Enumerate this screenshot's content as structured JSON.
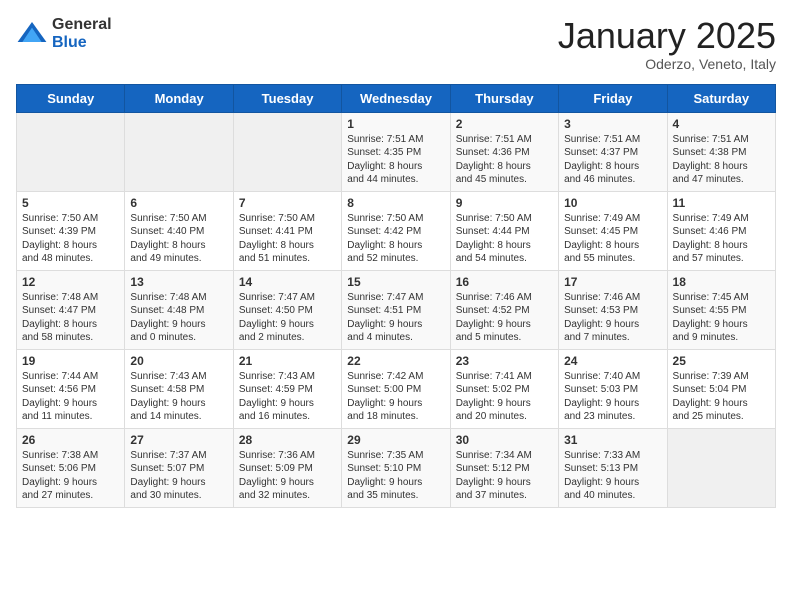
{
  "logo": {
    "general": "General",
    "blue": "Blue"
  },
  "header": {
    "month": "January 2025",
    "location": "Oderzo, Veneto, Italy"
  },
  "weekdays": [
    "Sunday",
    "Monday",
    "Tuesday",
    "Wednesday",
    "Thursday",
    "Friday",
    "Saturday"
  ],
  "weeks": [
    [
      {
        "day": "",
        "info": ""
      },
      {
        "day": "",
        "info": ""
      },
      {
        "day": "",
        "info": ""
      },
      {
        "day": "1",
        "info": "Sunrise: 7:51 AM\nSunset: 4:35 PM\nDaylight: 8 hours\nand 44 minutes."
      },
      {
        "day": "2",
        "info": "Sunrise: 7:51 AM\nSunset: 4:36 PM\nDaylight: 8 hours\nand 45 minutes."
      },
      {
        "day": "3",
        "info": "Sunrise: 7:51 AM\nSunset: 4:37 PM\nDaylight: 8 hours\nand 46 minutes."
      },
      {
        "day": "4",
        "info": "Sunrise: 7:51 AM\nSunset: 4:38 PM\nDaylight: 8 hours\nand 47 minutes."
      }
    ],
    [
      {
        "day": "5",
        "info": "Sunrise: 7:50 AM\nSunset: 4:39 PM\nDaylight: 8 hours\nand 48 minutes."
      },
      {
        "day": "6",
        "info": "Sunrise: 7:50 AM\nSunset: 4:40 PM\nDaylight: 8 hours\nand 49 minutes."
      },
      {
        "day": "7",
        "info": "Sunrise: 7:50 AM\nSunset: 4:41 PM\nDaylight: 8 hours\nand 51 minutes."
      },
      {
        "day": "8",
        "info": "Sunrise: 7:50 AM\nSunset: 4:42 PM\nDaylight: 8 hours\nand 52 minutes."
      },
      {
        "day": "9",
        "info": "Sunrise: 7:50 AM\nSunset: 4:44 PM\nDaylight: 8 hours\nand 54 minutes."
      },
      {
        "day": "10",
        "info": "Sunrise: 7:49 AM\nSunset: 4:45 PM\nDaylight: 8 hours\nand 55 minutes."
      },
      {
        "day": "11",
        "info": "Sunrise: 7:49 AM\nSunset: 4:46 PM\nDaylight: 8 hours\nand 57 minutes."
      }
    ],
    [
      {
        "day": "12",
        "info": "Sunrise: 7:48 AM\nSunset: 4:47 PM\nDaylight: 8 hours\nand 58 minutes."
      },
      {
        "day": "13",
        "info": "Sunrise: 7:48 AM\nSunset: 4:48 PM\nDaylight: 9 hours\nand 0 minutes."
      },
      {
        "day": "14",
        "info": "Sunrise: 7:47 AM\nSunset: 4:50 PM\nDaylight: 9 hours\nand 2 minutes."
      },
      {
        "day": "15",
        "info": "Sunrise: 7:47 AM\nSunset: 4:51 PM\nDaylight: 9 hours\nand 4 minutes."
      },
      {
        "day": "16",
        "info": "Sunrise: 7:46 AM\nSunset: 4:52 PM\nDaylight: 9 hours\nand 5 minutes."
      },
      {
        "day": "17",
        "info": "Sunrise: 7:46 AM\nSunset: 4:53 PM\nDaylight: 9 hours\nand 7 minutes."
      },
      {
        "day": "18",
        "info": "Sunrise: 7:45 AM\nSunset: 4:55 PM\nDaylight: 9 hours\nand 9 minutes."
      }
    ],
    [
      {
        "day": "19",
        "info": "Sunrise: 7:44 AM\nSunset: 4:56 PM\nDaylight: 9 hours\nand 11 minutes."
      },
      {
        "day": "20",
        "info": "Sunrise: 7:43 AM\nSunset: 4:58 PM\nDaylight: 9 hours\nand 14 minutes."
      },
      {
        "day": "21",
        "info": "Sunrise: 7:43 AM\nSunset: 4:59 PM\nDaylight: 9 hours\nand 16 minutes."
      },
      {
        "day": "22",
        "info": "Sunrise: 7:42 AM\nSunset: 5:00 PM\nDaylight: 9 hours\nand 18 minutes."
      },
      {
        "day": "23",
        "info": "Sunrise: 7:41 AM\nSunset: 5:02 PM\nDaylight: 9 hours\nand 20 minutes."
      },
      {
        "day": "24",
        "info": "Sunrise: 7:40 AM\nSunset: 5:03 PM\nDaylight: 9 hours\nand 23 minutes."
      },
      {
        "day": "25",
        "info": "Sunrise: 7:39 AM\nSunset: 5:04 PM\nDaylight: 9 hours\nand 25 minutes."
      }
    ],
    [
      {
        "day": "26",
        "info": "Sunrise: 7:38 AM\nSunset: 5:06 PM\nDaylight: 9 hours\nand 27 minutes."
      },
      {
        "day": "27",
        "info": "Sunrise: 7:37 AM\nSunset: 5:07 PM\nDaylight: 9 hours\nand 30 minutes."
      },
      {
        "day": "28",
        "info": "Sunrise: 7:36 AM\nSunset: 5:09 PM\nDaylight: 9 hours\nand 32 minutes."
      },
      {
        "day": "29",
        "info": "Sunrise: 7:35 AM\nSunset: 5:10 PM\nDaylight: 9 hours\nand 35 minutes."
      },
      {
        "day": "30",
        "info": "Sunrise: 7:34 AM\nSunset: 5:12 PM\nDaylight: 9 hours\nand 37 minutes."
      },
      {
        "day": "31",
        "info": "Sunrise: 7:33 AM\nSunset: 5:13 PM\nDaylight: 9 hours\nand 40 minutes."
      },
      {
        "day": "",
        "info": ""
      }
    ]
  ]
}
